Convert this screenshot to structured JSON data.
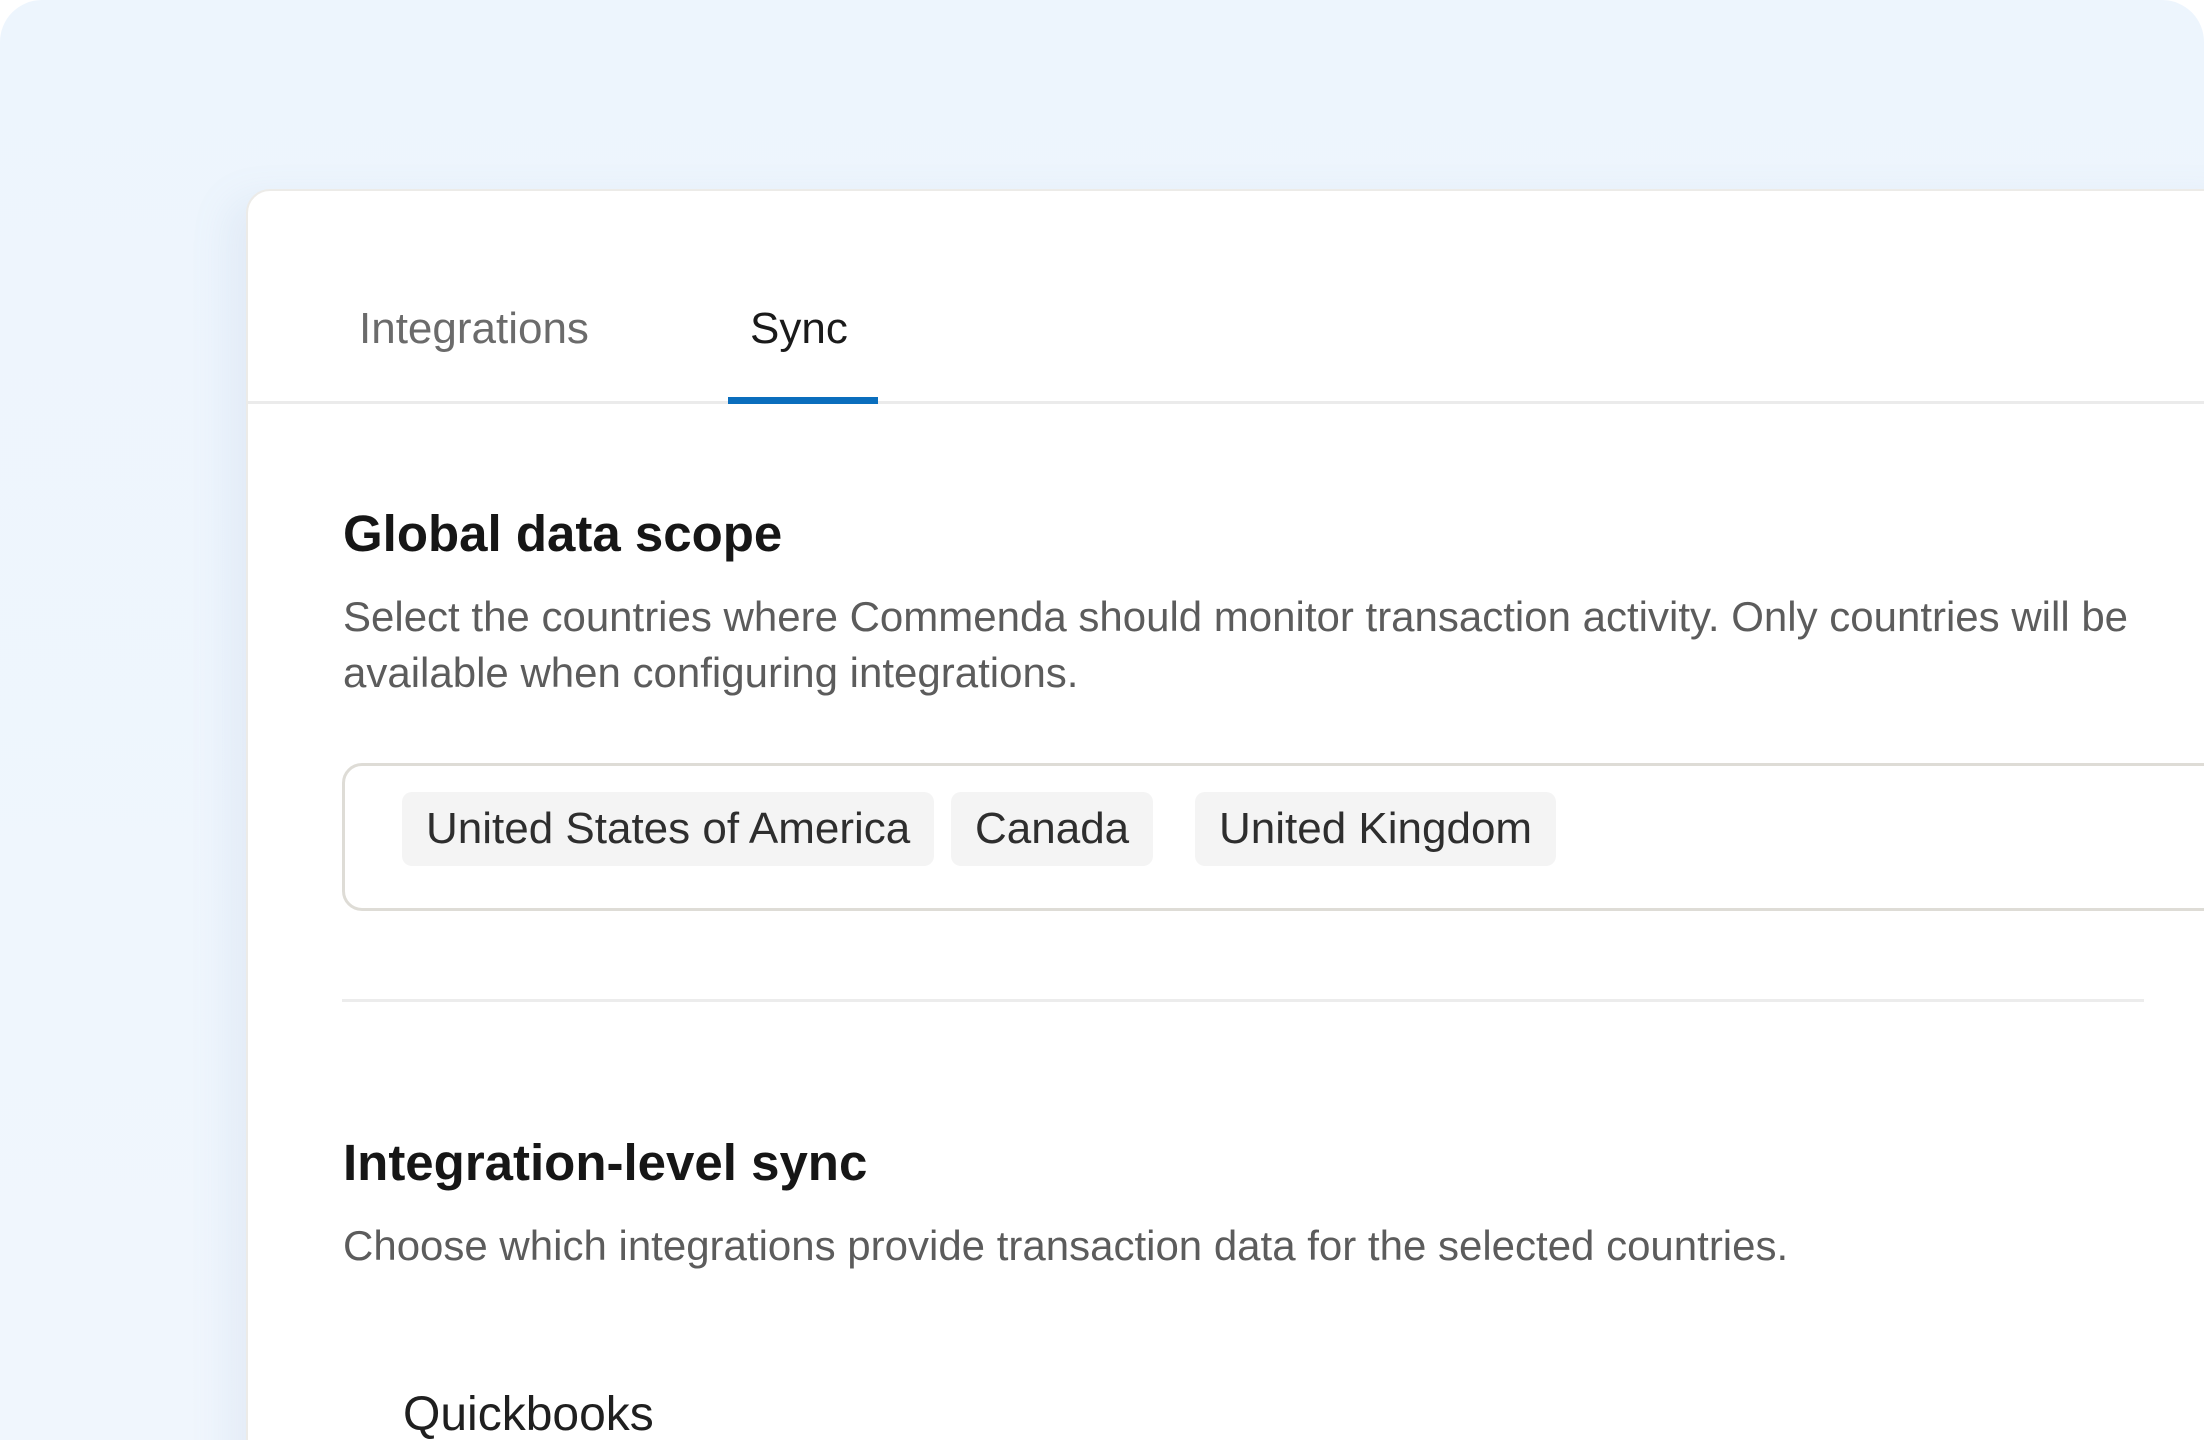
{
  "tabs": [
    {
      "label": "Integrations",
      "active": false
    },
    {
      "label": "Sync",
      "active": true
    }
  ],
  "global_scope": {
    "title": "Global data scope",
    "description": "Select the countries where Commenda should monitor transaction activity. Only countries will be available when configuring integrations.",
    "countries": [
      "United States of America",
      "Canada",
      "United Kingdom"
    ]
  },
  "integration_sync": {
    "title": "Integration-level sync",
    "description": "Choose which integrations provide transaction data for the selected countries.",
    "integrations": [
      "Quickbooks"
    ]
  },
  "colors": {
    "accent": "#0a6ebd",
    "background": "#edf5fd",
    "chip": "#f4f4f4"
  }
}
